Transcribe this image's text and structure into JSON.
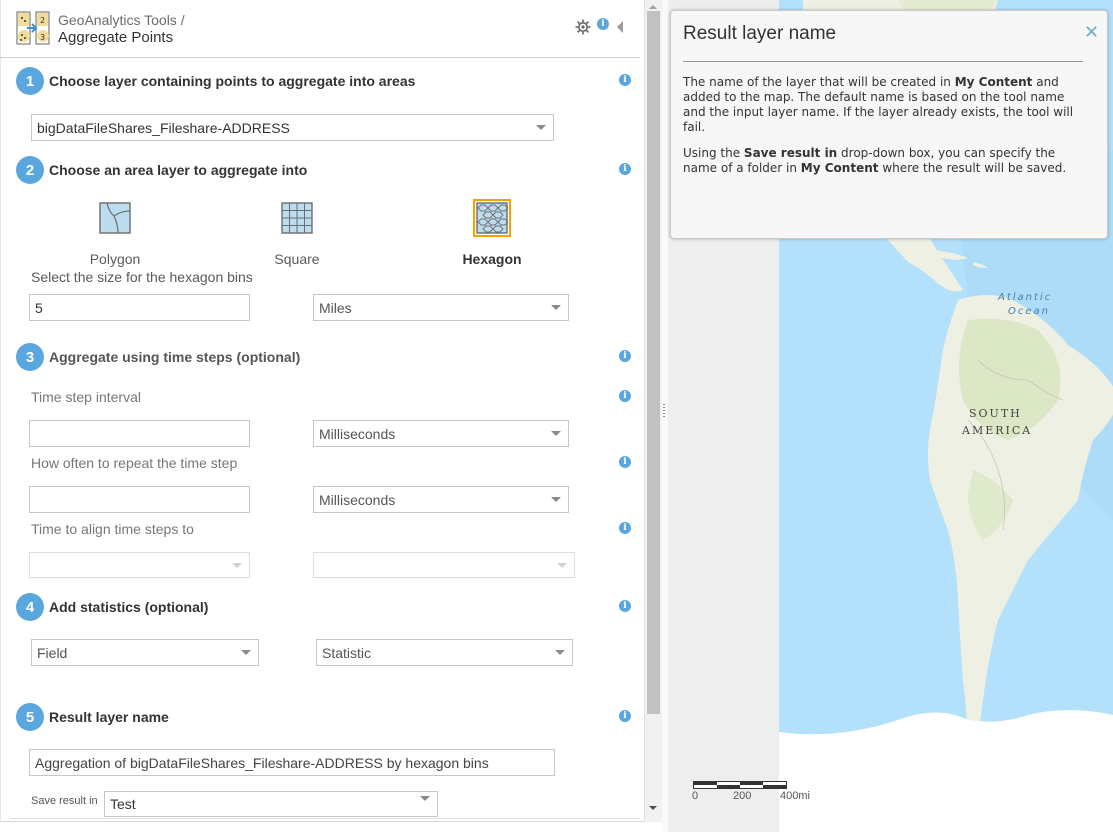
{
  "header": {
    "breadcrumb": "GeoAnalytics Tools /",
    "title": "Aggregate Points",
    "icons": [
      "gear-icon",
      "info-icon",
      "collapse-arrow-icon"
    ]
  },
  "steps": [
    {
      "number": "1",
      "label": "Choose layer containing points to aggregate into areas"
    },
    {
      "number": "2",
      "label": "Choose an area layer to aggregate into"
    },
    {
      "number": "3",
      "label": "Aggregate using time steps (optional)"
    },
    {
      "number": "4",
      "label": "Add statistics (optional)"
    },
    {
      "number": "5",
      "label": "Result layer name"
    }
  ],
  "step1": {
    "input_layer": "bigDataFileShares_Fileshare-ADDRESS"
  },
  "step2": {
    "options": [
      {
        "label": "Polygon",
        "icon": "polygon-icon",
        "selected": false
      },
      {
        "label": "Square",
        "icon": "square-grid-icon",
        "selected": false
      },
      {
        "label": "Hexagon",
        "icon": "hexagon-grid-icon",
        "selected": true
      }
    ],
    "bin_size_label": "Select the size for the hexagon bins",
    "bin_size_value": "5",
    "bin_units": "Miles"
  },
  "step3": {
    "interval_label": "Time step interval",
    "interval_value": "",
    "interval_units": "Milliseconds",
    "repeat_label": "How often to repeat the time step",
    "repeat_value": "",
    "repeat_units": "Milliseconds",
    "align_label": "Time to align time steps to",
    "align_date": "",
    "align_time": ""
  },
  "step4": {
    "field": "Field",
    "statistic": "Statistic"
  },
  "step5": {
    "result_name": "Aggregation of bigDataFileShares_Fileshare-ADDRESS by hexagon bins",
    "save_label": "Save result in",
    "save_folder": "Test"
  },
  "help": {
    "title": "Result layer name",
    "close_icon": "close-icon",
    "p1_a": "The name of the layer that will be created in ",
    "p1_b": "My Content",
    "p1_c": " and added to the map. The default name is based on the tool name and the input layer name. If the layer already exists, the tool will fail.",
    "p2_a": "Using the ",
    "p2_b": "Save result in",
    "p2_c": " drop-down box, you can specify the name of a folder in ",
    "p2_d": "My Content",
    "p2_e": " where the result will be saved."
  },
  "map": {
    "labels": {
      "atlantic_1": "Atlantic",
      "atlantic_2": "Ocean",
      "south": "SOUTH",
      "america": "AMERICA"
    },
    "scale": {
      "zero": "0",
      "mid": "200",
      "end": "400mi"
    }
  },
  "colors": {
    "accent": "#5aa6de",
    "selected_outline": "#f5a200",
    "ocean": "#b3e1fb",
    "land": "#f3f3ef"
  }
}
